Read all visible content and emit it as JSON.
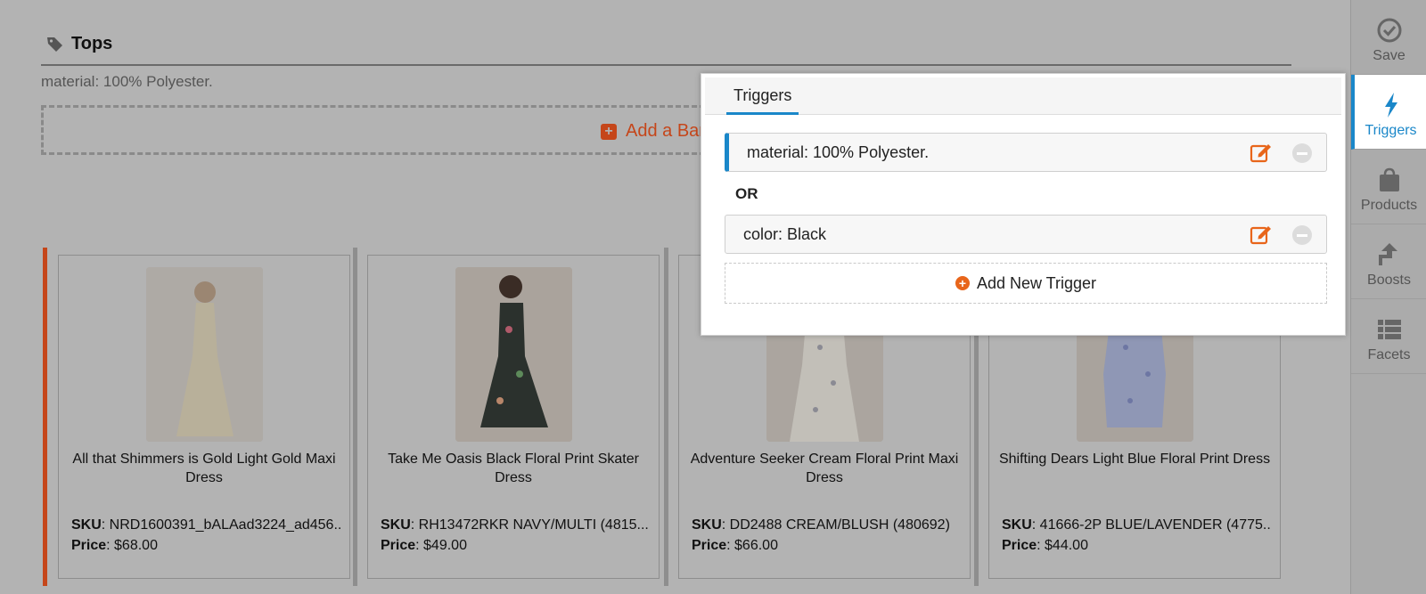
{
  "category": {
    "title": "Tops",
    "description": "material: 100% Polyester."
  },
  "banner": {
    "add_label": "Add a Ban"
  },
  "products": [
    {
      "name": "All that Shimmers is Gold Light Gold Maxi Dress",
      "sku_label": "SKU",
      "sku": ": NRD1600391_bALAad3224_ad456..",
      "price_label": "Price",
      "price": ": $68.00"
    },
    {
      "name": "Take Me Oasis Black Floral Print Skater Dress",
      "sku_label": "SKU",
      "sku": ": RH13472RKR NAVY/MULTI (4815...",
      "price_label": "Price",
      "price": ": $49.00"
    },
    {
      "name": "Adventure Seeker Cream Floral Print Maxi Dress",
      "sku_label": "SKU",
      "sku": ": DD2488 CREAM/BLUSH (480692)",
      "price_label": "Price",
      "price": ": $66.00"
    },
    {
      "name": "Shifting Dears Light Blue Floral Print Dress",
      "sku_label": "SKU",
      "sku": ": 41666-2P BLUE/LAVENDER (4775...",
      "price_label": "Price",
      "price": ": $44.00"
    }
  ],
  "sidebar": {
    "items": [
      {
        "label": "Save",
        "icon": "check-circle-icon"
      },
      {
        "label": "Triggers",
        "icon": "lightning-icon"
      },
      {
        "label": "Products",
        "icon": "shopping-bag-icon"
      },
      {
        "label": "Boosts",
        "icon": "boost-arrow-icon"
      },
      {
        "label": "Facets",
        "icon": "list-icon"
      }
    ]
  },
  "triggers_panel": {
    "tab_label": "Triggers",
    "triggers": [
      {
        "label": "material: 100% Polyester."
      },
      {
        "label": "color: Black"
      }
    ],
    "or_label": "OR",
    "add_label": "Add New Trigger"
  },
  "colors": {
    "accent_orange": "#e8651a",
    "accent_blue": "#1a87c9",
    "overlay_gray": "#b3b3b3"
  }
}
